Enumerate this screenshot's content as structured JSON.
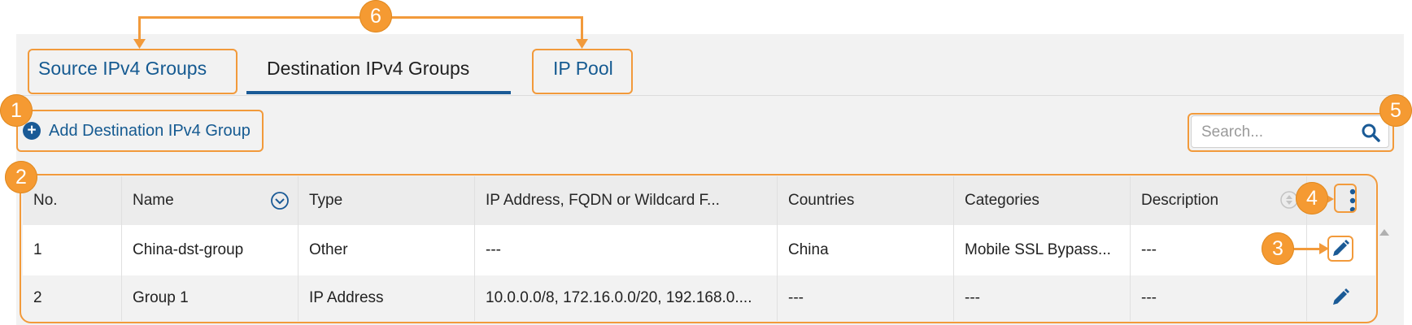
{
  "tabs": [
    {
      "label": "Source IPv4 Groups"
    },
    {
      "label": "Destination IPv4 Groups"
    },
    {
      "label": "IP Pool"
    }
  ],
  "toolbar": {
    "add_label": "Add Destination IPv4 Group",
    "add_icon": "plus-circle-icon",
    "search_placeholder": "Search...",
    "search_icon": "search-icon"
  },
  "table": {
    "columns": [
      "No.",
      "Name",
      "Type",
      "IP Address, FQDN or Wildcard F...",
      "Countries",
      "Categories",
      "Description"
    ],
    "rows": [
      {
        "no": "1",
        "name": "China-dst-group",
        "type": "Other",
        "ip": "---",
        "countries": "China",
        "categories": "Mobile SSL Bypass...",
        "description": "---"
      },
      {
        "no": "2",
        "name": "Group 1",
        "type": "IP Address",
        "ip": "10.0.0.0/8, 172.16.0.0/20, 192.168.0....",
        "countries": "---",
        "categories": "---",
        "description": "---"
      }
    ]
  },
  "callouts": [
    "1",
    "2",
    "3",
    "4",
    "5",
    "6"
  ],
  "colors": {
    "accent": "#1a5a96",
    "link": "#155a91",
    "callout": "#f59a32"
  }
}
